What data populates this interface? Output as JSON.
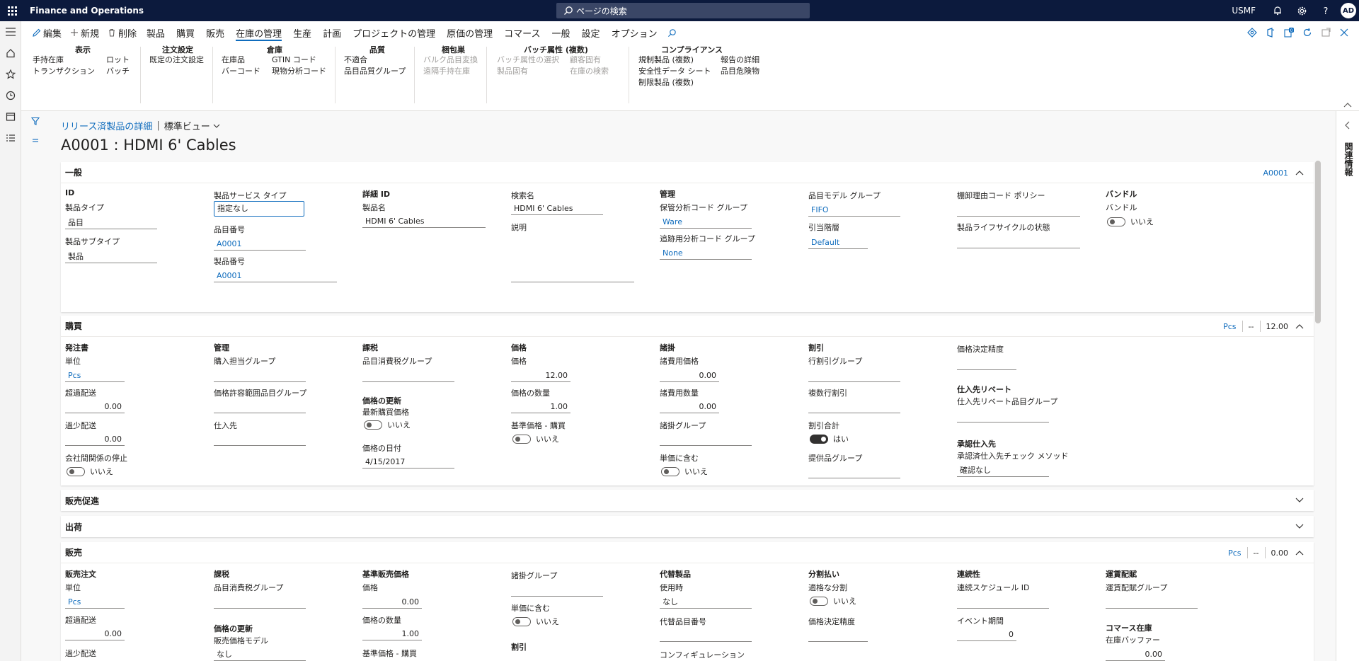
{
  "app": {
    "title": "Finance and Operations",
    "search_placeholder": "ページの検索",
    "company": "USMF",
    "avatar": "AD"
  },
  "actions": {
    "edit": "編集",
    "new": "新規",
    "delete": "削除"
  },
  "tabs": [
    "製品",
    "購買",
    "販売",
    "在庫の管理",
    "生産",
    "計画",
    "プロジェクトの管理",
    "原価の管理",
    "コマース",
    "一般",
    "設定",
    "オプション"
  ],
  "active_tab": "在庫の管理",
  "ribbon": {
    "g1": {
      "title": "表示",
      "items": [
        "手持在庫",
        "トランザクション",
        "ロット",
        "バッチ"
      ]
    },
    "g2": {
      "title": "注文設定",
      "items": [
        "既定の注文設定"
      ]
    },
    "g3": {
      "title": "倉庫",
      "items": [
        "在庫品",
        "バーコード",
        "GTIN コード",
        "現物分析コード"
      ]
    },
    "g4": {
      "title": "品質",
      "items": [
        "不適合",
        "品目品質グループ"
      ]
    },
    "g5": {
      "title": "梱包巣",
      "items": [
        "バルク品目変換",
        "遠隔手持在庫"
      ]
    },
    "g6": {
      "title": "バッチ属性 (複数)",
      "items": [
        "バッチ属性の選択",
        "製品固有",
        "顧客固有",
        "在庫の検索"
      ]
    },
    "g7": {
      "title": "コンプライアンス",
      "items": [
        "規制製品 (複数)",
        "安全性データ シート",
        "制限製品 (複数)",
        "報告の詳細",
        "品目危険物"
      ]
    }
  },
  "right_pane": {
    "label": "関連情報"
  },
  "breadcrumb": {
    "link": "リリース済製品の詳細",
    "view": "標準ビュー"
  },
  "page_title": "A0001 : HDMI 6' Cables",
  "general": {
    "header": "一般",
    "summary": "A0001",
    "col1": {
      "g": "ID",
      "l1": "製品タイプ",
      "v1": "品目",
      "l2": "製品サブタイプ",
      "v2": "製品"
    },
    "col2": {
      "l1": "製品サービス タイプ",
      "v1": "指定なし",
      "l2": "品目番号",
      "v2": "A0001",
      "l3": "製品番号",
      "v3": "A0001"
    },
    "col3": {
      "g": "詳細 ID",
      "l1": "製品名",
      "v1": "HDMI 6' Cables"
    },
    "col4": {
      "l1": "検索名",
      "v1": "HDMI 6' Cables",
      "l2": "説明"
    },
    "col5": {
      "g": "管理",
      "l1": "保管分析コード グループ",
      "v1": "Ware",
      "l2": "追跡用分析コード グループ",
      "v2": "None"
    },
    "col6": {
      "l1": "品目モデル グループ",
      "v1": "FIFO",
      "l2": "引当階層",
      "v2": "Default"
    },
    "col7": {
      "l1": "棚卸理由コード ポリシー",
      "l2": "製品ライフサイクルの状態"
    },
    "col8": {
      "g": "バンドル",
      "l1": "バンドル",
      "v1": "いいえ"
    }
  },
  "purchase": {
    "header": "購買",
    "summary": [
      "Pcs",
      "--",
      "12.00"
    ],
    "c1": {
      "g": "発注書",
      "l1": "単位",
      "v1": "Pcs",
      "l2": "超過配送",
      "v2": "0.00",
      "l3": "過少配送",
      "v3": "0.00",
      "l4": "会社間関係の停止",
      "v4": "いいえ"
    },
    "c2": {
      "g": "管理",
      "l1": "購入担当グループ",
      "l2": "価格許容範囲品目グループ",
      "l3": "仕入先"
    },
    "c3": {
      "g": "課税",
      "l1": "品目消費税グループ",
      "g2": "価格の更新",
      "l2": "最新購買価格",
      "v2": "いいえ",
      "l3": "価格の日付",
      "v3": "4/15/2017"
    },
    "c4": {
      "g": "価格",
      "l1": "価格",
      "v1": "12.00",
      "l2": "価格の数量",
      "v2": "1.00",
      "l3": "基準価格 - 購買",
      "v3": "いいえ"
    },
    "c5": {
      "g": "諸掛",
      "l1": "諸費用価格",
      "v1": "0.00",
      "l2": "諸費用数量",
      "v2": "0.00",
      "l3": "諸掛グループ",
      "l4": "単価に含む",
      "v4": "いいえ"
    },
    "c6": {
      "g": "割引",
      "l1": "行割引グループ",
      "l2": "複数行割引",
      "l3": "割引合計",
      "v3": "はい",
      "l4": "提供品グループ"
    },
    "c7": {
      "l1": "価格決定精度",
      "g2": "仕入先リベート",
      "l2": "仕入先リベート品目グループ",
      "g3": "承認仕入先",
      "l3": "承認済仕入先チェック メソッド",
      "v3": "確認なし"
    }
  },
  "promotion": {
    "header": "販売促進"
  },
  "shipment": {
    "header": "出荷"
  },
  "sales": {
    "header": "販売",
    "summary": [
      "Pcs",
      "--",
      "0.00"
    ],
    "c1": {
      "g": "販売注文",
      "l1": "単位",
      "v1": "Pcs",
      "l2": "超過配送",
      "v2": "0.00",
      "l3": "過少配送"
    },
    "c2": {
      "g": "課税",
      "l1": "品目消費税グループ",
      "g2": "価格の更新",
      "l2": "販売価格モデル",
      "v2": "なし"
    },
    "c3": {
      "g": "基準販売価格",
      "l1": "価格",
      "v1": "0.00",
      "l2": "価格の数量",
      "v2": "1.00",
      "l3": "基準価格 - 購買"
    },
    "c4": {
      "l1": "諸掛グループ",
      "l2": "単価に含む",
      "v2": "いいえ",
      "g3": "割引"
    },
    "c5": {
      "g": "代替製品",
      "l1": "使用時",
      "v1": "なし",
      "l2": "代替品目番号",
      "l3": "コンフィギュレーション"
    },
    "c6": {
      "g": "分割払い",
      "l1": "適格な分割",
      "v1": "いいえ",
      "l2": "価格決定精度"
    },
    "c7": {
      "g": "連続性",
      "l1": "連続スケジュール ID",
      "l2": "イベント期間",
      "v2": "0"
    },
    "c8": {
      "g": "運賃配賦",
      "l1": "運賃配賦グループ",
      "g2": "コマース在庫",
      "l2": "在庫バッファー",
      "v2": "0.00"
    }
  }
}
